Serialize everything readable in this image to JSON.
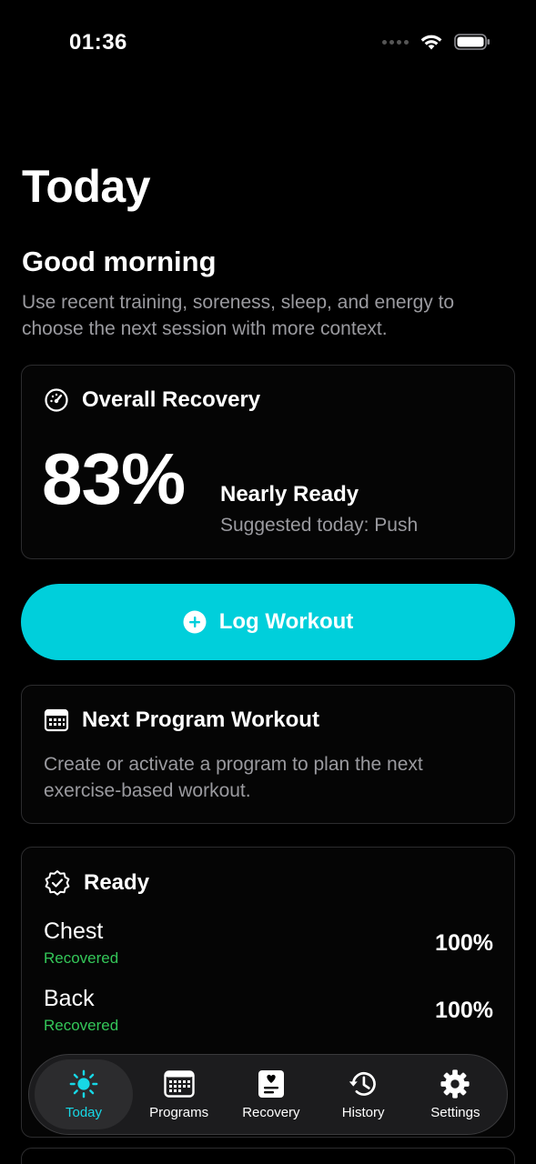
{
  "status_bar": {
    "time": "01:36"
  },
  "page": {
    "title": "Today",
    "greeting": "Good morning",
    "subtitle": "Use recent training, soreness, sleep, and energy to choose the next session with more context."
  },
  "recovery": {
    "title": "Overall Recovery",
    "percent_text": "83%",
    "percent_value": 83,
    "status": "Nearly Ready",
    "suggested": "Suggested today: Push"
  },
  "log_button": {
    "label": "Log Workout"
  },
  "next_program": {
    "title": "Next Program Workout",
    "description": "Create or activate a program to plan the next exercise-based workout."
  },
  "ready": {
    "title": "Ready",
    "muscles": [
      {
        "name": "Chest",
        "status": "Recovered",
        "percent": "100%"
      },
      {
        "name": "Back",
        "status": "Recovered",
        "percent": "100%"
      }
    ]
  },
  "tabs": [
    {
      "label": "Today",
      "icon": "sun-icon",
      "active": true
    },
    {
      "label": "Programs",
      "icon": "calendar-icon",
      "active": false
    },
    {
      "label": "Recovery",
      "icon": "heart-clipboard-icon",
      "active": false
    },
    {
      "label": "History",
      "icon": "history-icon",
      "active": false
    },
    {
      "label": "Settings",
      "icon": "gear-icon",
      "active": false
    }
  ],
  "colors": {
    "accent": "#00cfdb",
    "active_tab": "#17d8e6",
    "recovered": "#34c759",
    "secondary_text": "#9a9a9f",
    "card_border": "#2c2c2e"
  }
}
